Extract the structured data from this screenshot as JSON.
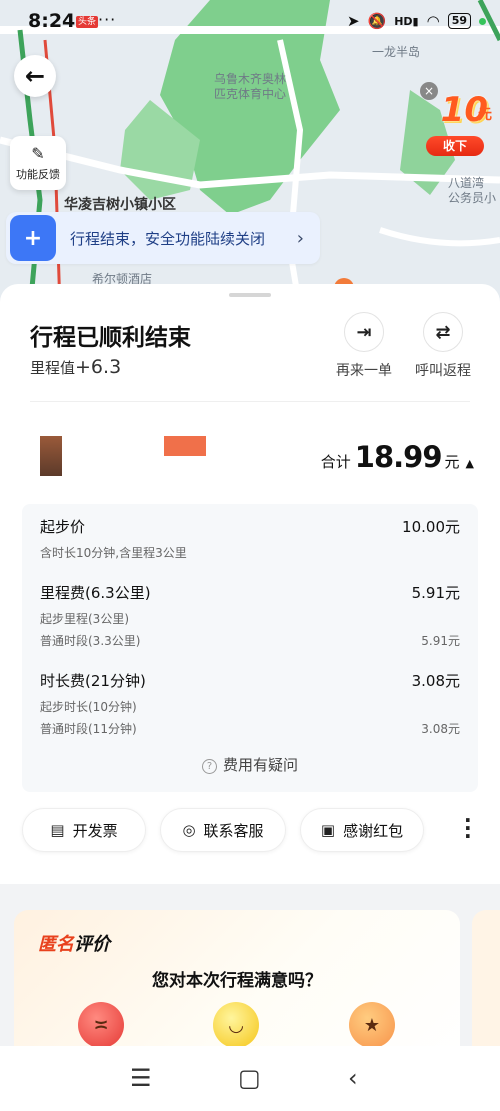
{
  "status_bar": {
    "time": "8:24",
    "app_badge": "头条",
    "dots": "···",
    "battery": "59"
  },
  "map": {
    "labels": [
      "乌鲁木齐奥林\n匹克体育中心",
      "一龙半岛",
      "八道湾\n公务员小",
      "希尔顿酒店",
      "华凌吉树小镇小区"
    ],
    "feedback_label": "功能反馈",
    "coupon": {
      "amount": "10",
      "unit": "元",
      "button": "收下"
    },
    "safety_notice": "行程结束，安全功能陆续关闭"
  },
  "trip": {
    "title": "行程已顺利结束",
    "mileage_label": "里程值",
    "mileage_value": "+6.3",
    "actions": [
      {
        "label": "再来一单",
        "icon": "reorder-icon"
      },
      {
        "label": "呼叫返程",
        "icon": "return-trip-icon"
      }
    ],
    "total_label": "合计",
    "total_amount": "18.99",
    "total_unit": "元"
  },
  "fees": {
    "base": {
      "name": "起步价",
      "value": "10.00元",
      "sub": "含时长10分钟,含里程3公里"
    },
    "distance": {
      "name": "里程费(6.3公里)",
      "value": "5.91元",
      "subs": [
        {
          "label": "起步里程(3公里)",
          "value": ""
        },
        {
          "label": "普通时段(3.3公里)",
          "value": "5.91元"
        }
      ]
    },
    "duration": {
      "name": "时长费(21分钟)",
      "value": "3.08元",
      "subs": [
        {
          "label": "起步时长(10分钟)",
          "value": ""
        },
        {
          "label": "普通时段(11分钟)",
          "value": "3.08元"
        }
      ]
    },
    "question": "费用有疑问"
  },
  "buttons": {
    "invoice": "开发票",
    "support": "联系客服",
    "red_packet": "感谢红包"
  },
  "rating": {
    "anon_prefix": "匿名",
    "anon_suffix": "评价",
    "question": "您对本次行程满意吗？"
  },
  "colors": {
    "accent_blue": "#3d77f6",
    "coupon_red": "#e62a12",
    "anon_red": "#e8411d"
  }
}
